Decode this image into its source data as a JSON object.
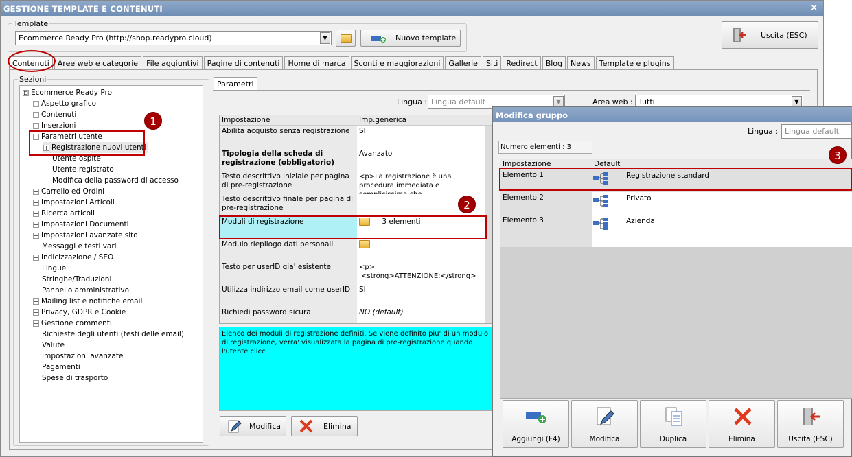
{
  "window": {
    "title": "GESTIONE TEMPLATE E CONTENUTI",
    "close": "×"
  },
  "template": {
    "legend": "Template",
    "selected": "Ecommerce Ready Pro (http://shop.readypro.cloud)",
    "new_label": "Nuovo template",
    "exit_label": "Uscita (ESC)"
  },
  "tabs": [
    "Contenuti",
    "Aree web e categorie",
    "File aggiuntivi",
    "Pagine di contenuti",
    "Home di marca",
    "Sconti e maggiorazioni",
    "Gallerie",
    "Siti",
    "Redirect",
    "Blog",
    "News",
    "Template e plugins"
  ],
  "sections": {
    "legend": "Sezioni",
    "nodes": [
      {
        "label": "Ecommerce Ready Pro",
        "sign": "⊟"
      },
      {
        "label": "Aspetto grafico",
        "sign": "+"
      },
      {
        "label": "Contenuti",
        "sign": "+"
      },
      {
        "label": "Inserzioni",
        "sign": "+"
      },
      {
        "label": "Parametri utente",
        "sign": "−"
      },
      {
        "label": "Registrazione nuovi utenti",
        "sign": "+"
      },
      {
        "label": "Utente ospite",
        "sign": ""
      },
      {
        "label": "Utente registrato",
        "sign": ""
      },
      {
        "label": "Modifica della password di accesso",
        "sign": ""
      },
      {
        "label": "Carrello ed Ordini",
        "sign": "+"
      },
      {
        "label": "Impostazioni Articoli",
        "sign": "+"
      },
      {
        "label": "Ricerca articoli",
        "sign": "+"
      },
      {
        "label": "Impostazioni Documenti",
        "sign": "+"
      },
      {
        "label": "Impostazioni avanzate sito",
        "sign": "+"
      },
      {
        "label": "Messaggi e testi vari",
        "sign": ""
      },
      {
        "label": "Indicizzazione / SEO",
        "sign": "+"
      },
      {
        "label": "Lingue",
        "sign": ""
      },
      {
        "label": "Stringhe/Traduzioni",
        "sign": ""
      },
      {
        "label": "Pannello amministrativo",
        "sign": ""
      },
      {
        "label": "Mailing list e notifiche email",
        "sign": "+"
      },
      {
        "label": "Privacy, GDPR e Cookie",
        "sign": "+"
      },
      {
        "label": "Gestione commenti",
        "sign": "+"
      },
      {
        "label": "Richieste degli utenti (testi delle email)",
        "sign": ""
      },
      {
        "label": "Valute",
        "sign": ""
      },
      {
        "label": "Impostazioni avanzate",
        "sign": ""
      },
      {
        "label": "Pagamenti",
        "sign": ""
      },
      {
        "label": "Spese di trasporto",
        "sign": ""
      }
    ]
  },
  "params": {
    "tab": "Parametri",
    "lingua_label": "Lingua :",
    "lingua_value": "Lingua default",
    "area_label": "Area web :",
    "area_value": "Tutti",
    "col_setting": "Impostazione",
    "col_value": "Imp.generica",
    "rows": [
      {
        "setting": "Abilita acquisto senza registrazione",
        "value": "SI"
      },
      {
        "setting": "Tipologia della scheda di registrazione (obbligatorio)",
        "value": "Avanzato"
      },
      {
        "setting": "Testo descrittivo iniziale per pagina di pre-registrazione",
        "value": "<p>La registrazione è una procedura immediata e semplicissima che"
      },
      {
        "setting": "Testo descrittivo finale per pagina di pre-registrazione",
        "value": ""
      },
      {
        "setting": "Moduli di registrazione",
        "value": "3 elementi"
      },
      {
        "setting": "Modulo riepilogo dati personali",
        "value": ""
      },
      {
        "setting": "Testo per userID gia' esistente",
        "value": "<p>\n <strong>ATTENZIONE:</strong>"
      },
      {
        "setting": "Utilizza indirizzo email come userID",
        "value": "SI"
      },
      {
        "setting": "Richiedi password sicura",
        "value": "NO (default)"
      }
    ],
    "description": "Elenco dei moduli di registrazione definiti. Se viene definito piu' di un modulo di registrazione, verra' visualizzata la pagina di pre-registrazione quando l'utente clicc",
    "modifica": "Modifica",
    "elimina": "Elimina"
  },
  "dialog": {
    "title": "Modifica gruppo",
    "lingua_label": "Lingua :",
    "lingua_value": "Lingua default",
    "count": "Numero elementi : 3",
    "col_setting": "Impostazione",
    "col_default": "Default",
    "rows": [
      {
        "setting": "Elemento 1",
        "value": "Registrazione standard"
      },
      {
        "setting": "Elemento 2",
        "value": "Privato"
      },
      {
        "setting": "Elemento 3",
        "value": "Azienda"
      }
    ],
    "buttons": [
      "Aggiungi (F4)",
      "Modifica",
      "Duplica",
      "Elimina",
      "Uscita (ESC)"
    ]
  },
  "badges": [
    "1",
    "2",
    "3"
  ],
  "colors": {
    "highlight": "#aef0f5",
    "description_bg": "#00ffff",
    "annotation": "#c00000",
    "title_bar": "#7a96bd"
  }
}
